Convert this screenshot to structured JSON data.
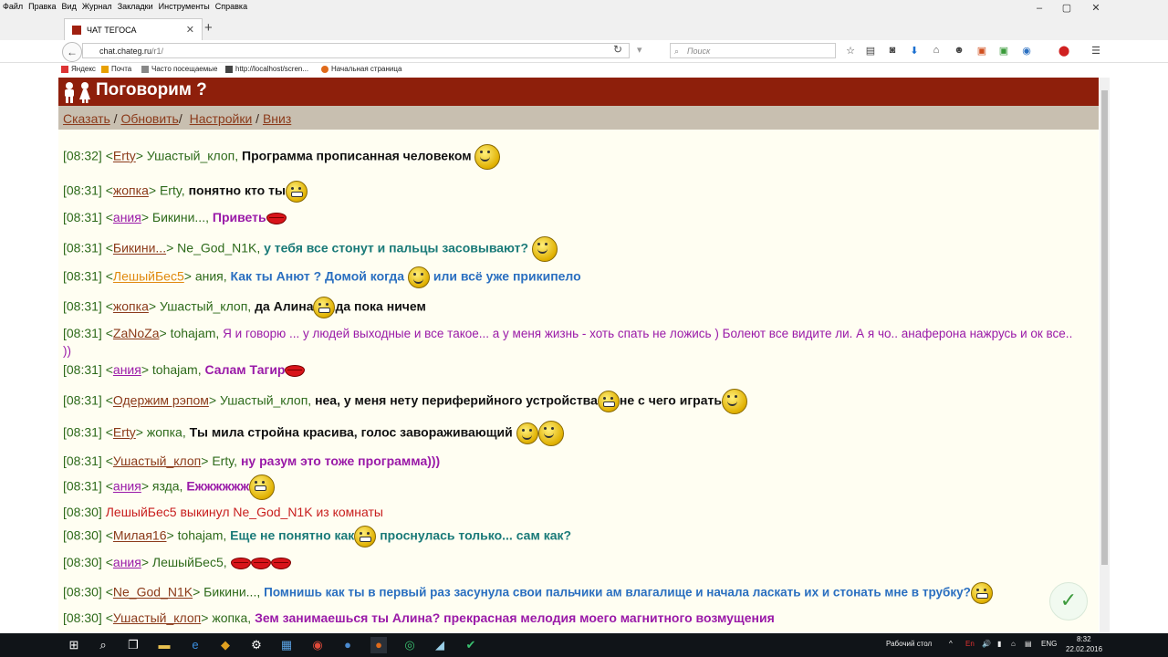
{
  "browser": {
    "menu": [
      "Файл",
      "Правка",
      "Вид",
      "Журнал",
      "Закладки",
      "Инструменты",
      "Справка"
    ],
    "window_controls": [
      "–",
      "▢",
      "✕"
    ],
    "tab_title": "ЧАТ ТЕГОСА",
    "tab_close": "✕",
    "new_tab": "+",
    "back_glyph": "←",
    "url_domain": "chat.chateg.ru",
    "url_path": "/r1/",
    "search_placeholder": "Поиск",
    "bookmarks": [
      "Яндекс",
      "Почта",
      "Часто посещаемые",
      "http://localhost/scren...",
      "Начальная страница"
    ],
    "toolbar_icons": [
      "star-icon",
      "reader-icon",
      "pocket-icon",
      "download-icon",
      "home-icon",
      "chat-icon",
      "ext-icon",
      "ext2-icon",
      "sync-icon",
      "adblock-icon",
      "menu-icon"
    ]
  },
  "site": {
    "title": "Поговорим ?",
    "links": [
      "Сказать",
      "Обновить",
      "Настройки",
      "Вниз"
    ]
  },
  "messages": [
    {
      "time": "[08:32]",
      "nick": "Erty",
      "to": "Ушастый_клоп,",
      "text": "Программа прописанная человеком"
    },
    {
      "time": "[08:31]",
      "nick": "жопка",
      "to": "Erty,",
      "text": "понятно кто ты"
    },
    {
      "time": "[08:31]",
      "nick": "ания",
      "to": "Бикини...,",
      "text": "Приветь"
    },
    {
      "time": "[08:31]",
      "nick": "Бикини...",
      "to": "Ne_God_N1K,",
      "text": "у тебя все стонут и пальцы засовывают?"
    },
    {
      "time": "[08:31]",
      "nick": "ЛешыйБес5",
      "to": "ания,",
      "text": "Как ты Анют ? Домой когда",
      "text2": "или всё уже прикипело"
    },
    {
      "time": "[08:31]",
      "nick": "жопка",
      "to": "Ушастый_клоп,",
      "text": "да Алина",
      "text2": "да пока ничем"
    },
    {
      "time": "[08:31]",
      "nick": "ZaNoZa",
      "to": "tohajam,",
      "text": "Я и говорю ... у людей выходные и все такое... а у меня жизнь - хоть спать не ложись ) Болеют все видите ли. А я чо.. анаферона нажрусь и ок все.. ))"
    },
    {
      "time": "[08:31]",
      "nick": "ания",
      "to": "tohajam,",
      "text": "Салам Тагир"
    },
    {
      "time": "[08:31]",
      "nick": "Одержим рэпом",
      "to": "Ушастый_клоп,",
      "text": "неа, у меня нету периферийного устройства",
      "text2": "не с чего играть"
    },
    {
      "time": "[08:31]",
      "nick": "Erty",
      "to": "жопка,",
      "text": "Ты мила стройна красива, голос завораживающий"
    },
    {
      "time": "[08:31]",
      "nick": "Ушастый_клоп",
      "to": "Erty,",
      "text": "ну разум это тоже программа)))"
    },
    {
      "time": "[08:31]",
      "nick": "ания",
      "to": "язда,",
      "text": "Ежжжжжж"
    },
    {
      "time": "[08:30]",
      "system": "ЛешыйБес5 выкинул Ne_God_N1K из комнаты"
    },
    {
      "time": "[08:30]",
      "nick": "Милая16",
      "to": "tohajam,",
      "text": "Еще не понятно как",
      "text2": "проснулась только... сам как?"
    },
    {
      "time": "[08:30]",
      "nick": "ания",
      "to": "ЛешыйБес5,",
      "text": ""
    },
    {
      "time": "[08:30]",
      "nick": "Ne_God_N1K",
      "to": "Бикини...,",
      "text": "Помнишь как ты в первый раз засунула свои пальчики ам влагалище и начала ласкать их и стонать мне в трубку?"
    },
    {
      "time": "[08:30]",
      "nick": "Ушастый_клоп",
      "to": "жопка,",
      "text": "Зем занимаешься ты Алина? прекрасная мелодия моего магнитного возмущения"
    }
  ],
  "taskbar": {
    "desktop_label": "Рабочий стол",
    "lang": "ENG",
    "clock_time": "8:32",
    "clock_date": "22.02.2016"
  },
  "colors": {
    "header_bg": "#8e1f0b",
    "linkbar_bg": "#c8bfb0",
    "chat_bg": "#fffef2",
    "time_green": "#2d6a1a",
    "msg_black": "#111111",
    "msg_purple": "#9a1aa8",
    "msg_teal": "#1a7a78",
    "msg_blue": "#2a6fc0",
    "system_red": "#c81e1e"
  }
}
